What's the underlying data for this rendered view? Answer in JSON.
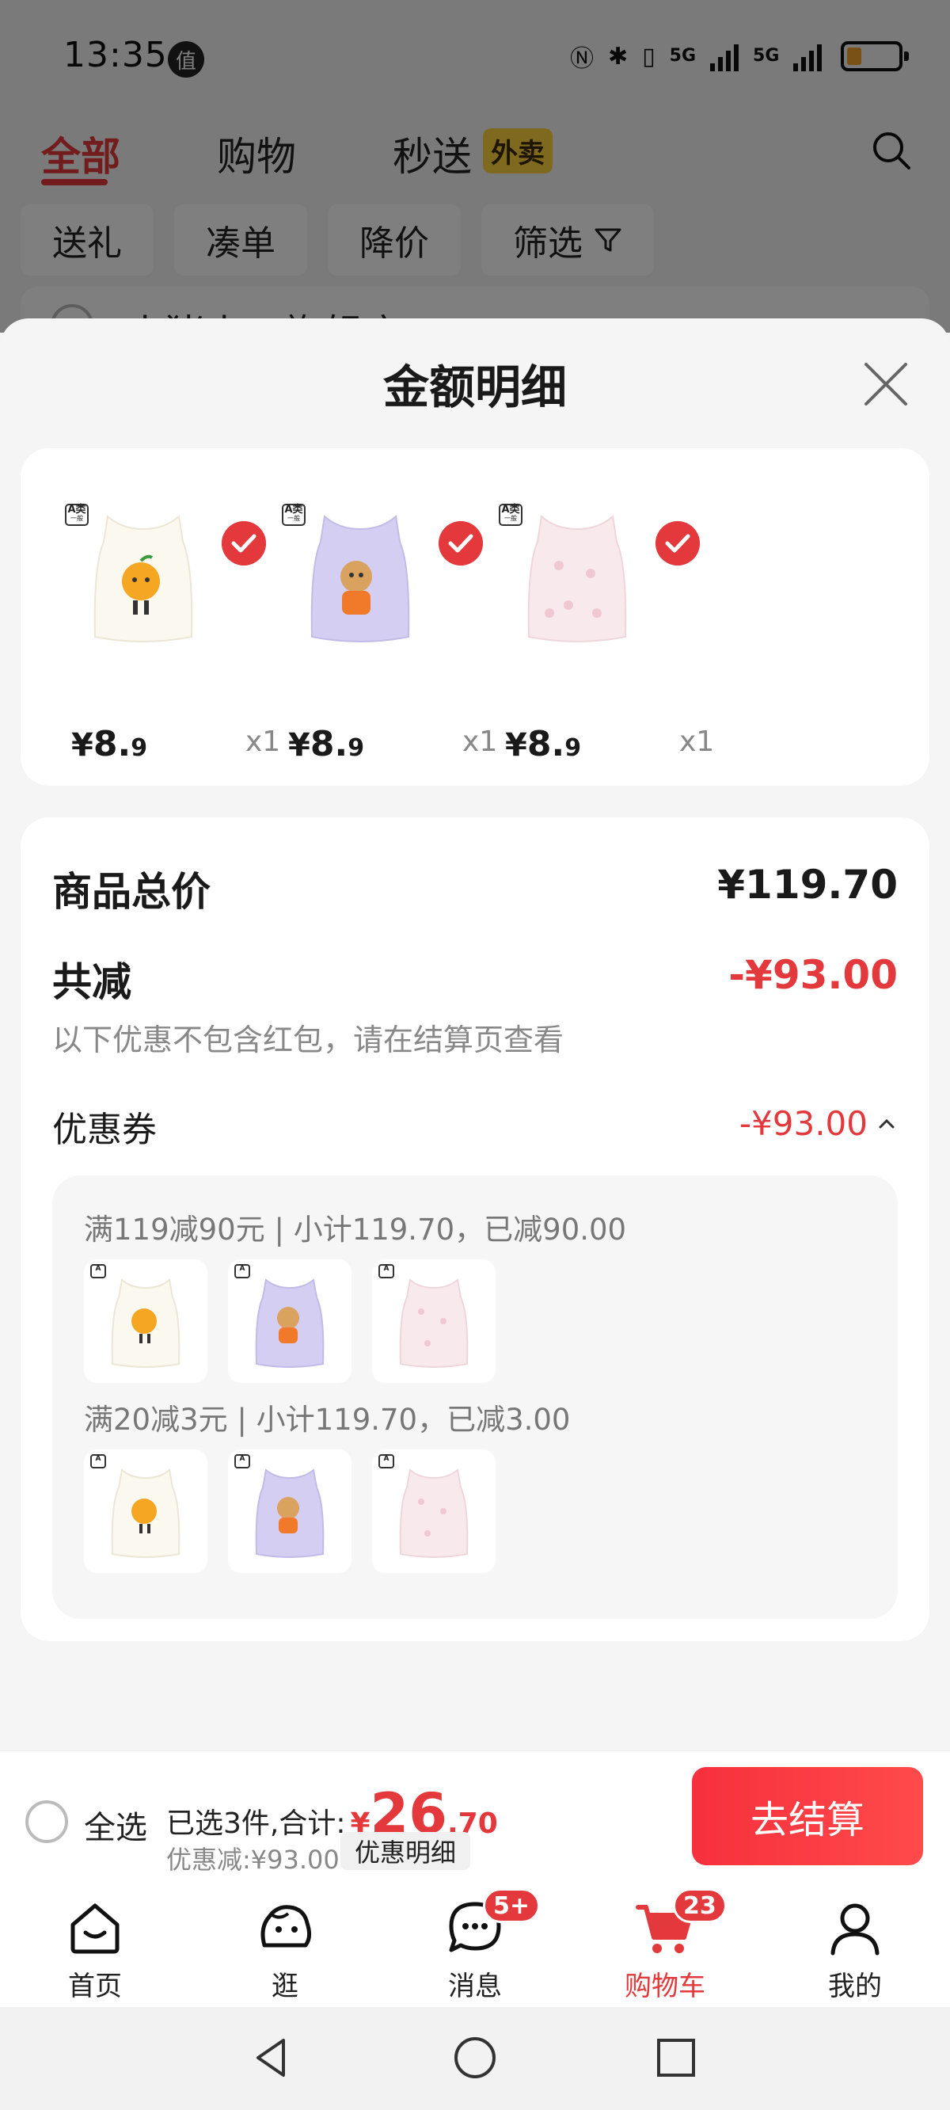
{
  "status_bar": {
    "time": "13:35",
    "zhi_badge": "值",
    "network_1": "5G",
    "network_2": "5G",
    "battery_level": 0.2
  },
  "top_tabs": {
    "all": "全部",
    "shopping": "购物",
    "fast": "秒送",
    "waimai_tag": "外卖"
  },
  "filters": [
    "送礼",
    "凑单",
    "降价",
    "筛选"
  ],
  "store_name_partial": "小猪小刀旗舰店",
  "sheet": {
    "title": "金额明细",
    "products": [
      {
        "badge_top": "A类",
        "badge_bottom": "一般",
        "price_int": "8.",
        "price_dec": "9",
        "currency": "¥",
        "qty": "x1",
        "selected": true,
        "variant": "orange"
      },
      {
        "badge_top": "A类",
        "badge_bottom": "一般",
        "price_int": "8.",
        "price_dec": "9",
        "currency": "¥",
        "qty": "x1",
        "selected": true,
        "variant": "purple"
      },
      {
        "badge_top": "A类",
        "badge_bottom": "一般",
        "price_int": "8.",
        "price_dec": "9",
        "currency": "¥",
        "qty": "x1",
        "selected": true,
        "variant": "pink"
      }
    ],
    "total_label": "商品总价",
    "total_value": "¥119.70",
    "reduce_label": "共减",
    "reduce_value": "-¥93.00",
    "note": "以下优惠不包含红包，请在结算页查看",
    "coupon_label": "优惠券",
    "coupon_value": "-¥93.00",
    "coupon_rules": [
      {
        "text": "满119减90元 | 小计119.70，已减90.00"
      },
      {
        "text": "满20减3元 | 小计119.70，已减3.00"
      }
    ]
  },
  "checkout": {
    "select_all": "全选",
    "summary_prefix": "已选3件,合计:",
    "currency": "¥",
    "total_int": "26",
    "total_dec": ".70",
    "discount": "优惠减:¥93.00",
    "detail_button": "优惠明细",
    "checkout_button": "去结算"
  },
  "bottom_nav": [
    {
      "label": "首页",
      "icon": "home-icon"
    },
    {
      "label": "逛",
      "icon": "browse-icon"
    },
    {
      "label": "消息",
      "icon": "message-icon",
      "badge": "5+"
    },
    {
      "label": "购物车",
      "icon": "cart-icon",
      "badge": "23",
      "active": true
    },
    {
      "label": "我的",
      "icon": "profile-icon"
    }
  ],
  "colors": {
    "accent_red": "#e4393c",
    "waimai_yellow": "#ffd23f",
    "vest_purple": "#cfcaf0",
    "vest_pink": "#f7e6ea"
  }
}
